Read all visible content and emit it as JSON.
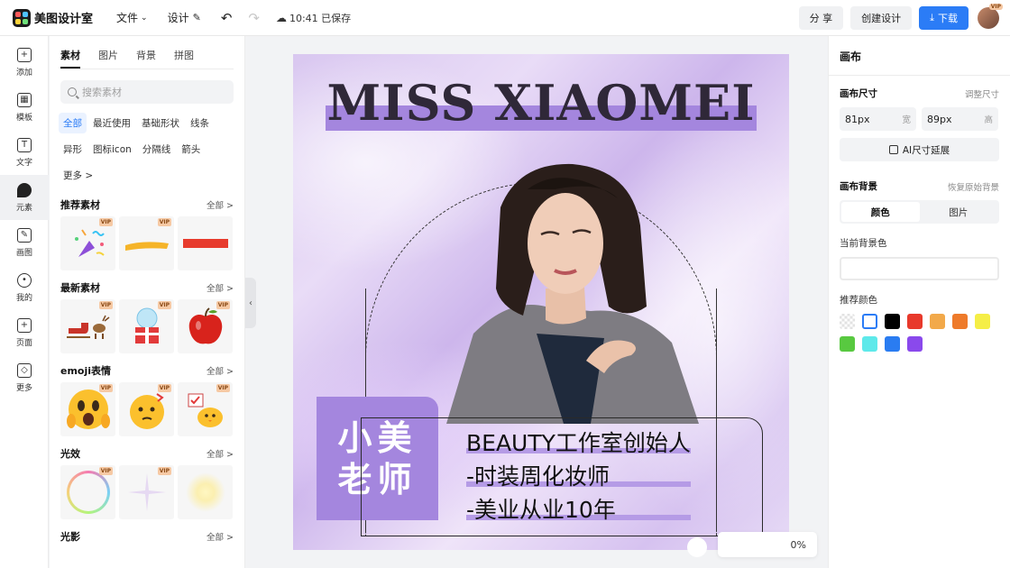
{
  "app": {
    "name": "美图设计室"
  },
  "toolbar": {
    "file_label": "文件",
    "design_label": "设计",
    "save_status": "10:41 已保存",
    "share_label": "分 享",
    "create_label": "创建设计",
    "download_label": "下载",
    "avatar_badge": "VIP"
  },
  "rail": {
    "items": [
      {
        "label": "添加",
        "icon": "plus-icon"
      },
      {
        "label": "模板",
        "icon": "template-icon"
      },
      {
        "label": "文字",
        "icon": "text-icon"
      },
      {
        "label": "元素",
        "icon": "shapes-icon"
      },
      {
        "label": "画图",
        "icon": "pencil-icon"
      },
      {
        "label": "我的",
        "icon": "user-icon"
      },
      {
        "label": "页面",
        "icon": "page-add-icon"
      },
      {
        "label": "更多",
        "icon": "cube-icon"
      }
    ],
    "active": 3
  },
  "assets": {
    "tabs": [
      "素材",
      "图片",
      "背景",
      "拼图"
    ],
    "search_placeholder": "搜索素材",
    "chips": [
      "全部",
      "最近使用",
      "基础形状",
      "线条",
      "异形",
      "图标icon",
      "分隔线",
      "箭头",
      "更多 >"
    ],
    "vip_badge": "VIP",
    "sections": [
      {
        "title": "推荐素材",
        "all": "全部 >"
      },
      {
        "title": "最新素材",
        "all": "全部 >"
      },
      {
        "title": "emoji表情",
        "all": "全部 >"
      },
      {
        "title": "光效",
        "all": "全部 >"
      },
      {
        "title": "光影",
        "all": "全部 >"
      }
    ]
  },
  "canvas": {
    "title": "MISS XIAOMEI",
    "name_line1": "小美",
    "name_line2": "老师",
    "info": [
      "BEAUTY工作室创始人",
      "-时装周化妆师",
      "-美业从业10年"
    ],
    "zoom": "0%"
  },
  "props": {
    "title": "画布",
    "size_label": "画布尺寸",
    "adjust_size": "调整尺寸",
    "width_value": "81px",
    "width_unit": "宽",
    "height_value": "89px",
    "height_unit": "高",
    "ai_extend": "AI尺寸延展",
    "bg_label": "画布背景",
    "restore_bg": "恢复原始背景",
    "seg_color": "颜色",
    "seg_image": "图片",
    "current_bg": "当前背景色",
    "recommended": "推荐颜色",
    "colors": [
      "transparent",
      "#ffffff",
      "#000000",
      "#e8392b",
      "#f2a94a",
      "#ee7a2a",
      "#f5ee46",
      "#58c940",
      "#5ee9ea",
      "#2a7cf1",
      "#8a49ec"
    ]
  }
}
